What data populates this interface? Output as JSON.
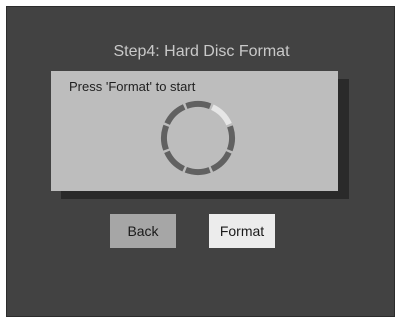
{
  "wizard": {
    "title": "Step4: Hard Disc Format",
    "instruction": "Press 'Format' to start"
  },
  "buttons": {
    "back_label": "Back",
    "format_label": "Format"
  },
  "progress_spinner": {
    "segments": 8,
    "highlighted_segment": 1
  },
  "colors": {
    "screen_bg": "#424242",
    "title_text": "#c9c9c9",
    "panel_bg": "#bdbdbd",
    "ring_segment": "#616161",
    "ring_highlight": "#e6e6e6",
    "back_button_bg": "#a6a6a6",
    "format_button_bg": "#ececec"
  }
}
